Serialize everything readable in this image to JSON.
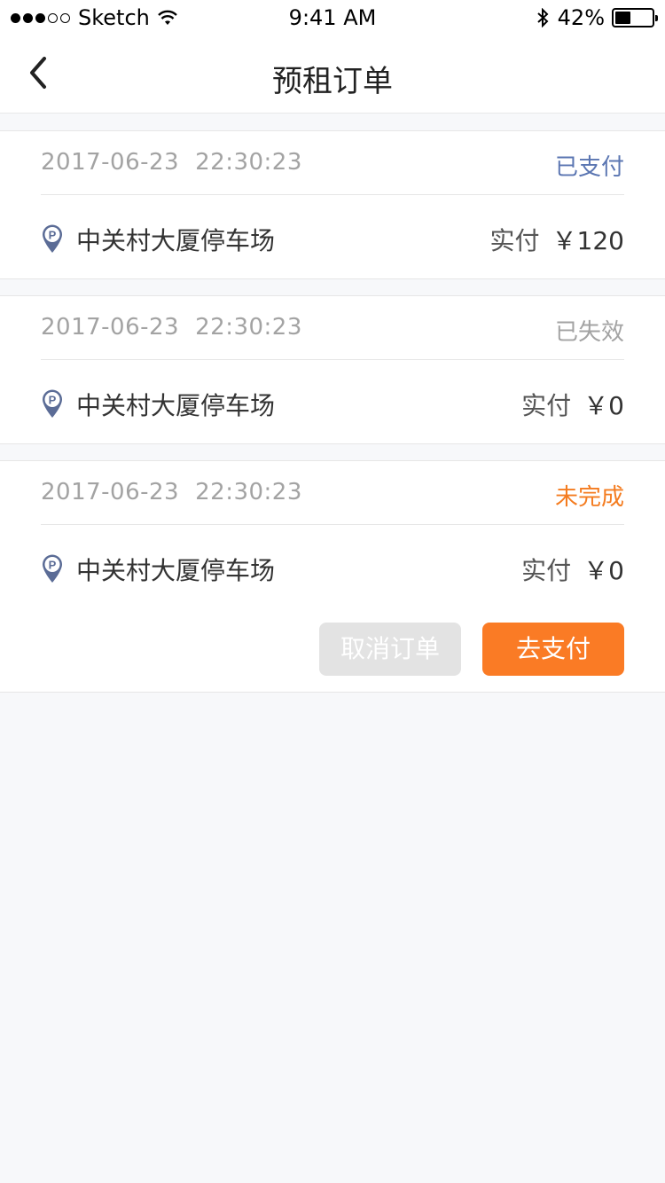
{
  "status_bar": {
    "carrier": "Sketch",
    "time": "9:41 AM",
    "battery_percent": "42%",
    "battery_level": 0.42
  },
  "nav": {
    "title": "预租订单",
    "back_icon": "chevron-left-icon"
  },
  "orders": [
    {
      "date": "2017-06-23",
      "time": "22:30:23",
      "status": "已支付",
      "status_color": "#5b76b2",
      "lot_name": "中关村大厦停车场",
      "paid_label": "实付",
      "amount": "￥120"
    },
    {
      "date": "2017-06-23",
      "time": "22:30:23",
      "status": "已失效",
      "status_color": "#a3a3a3",
      "lot_name": "中关村大厦停车场",
      "paid_label": "实付",
      "amount": "￥0"
    },
    {
      "date": "2017-06-23",
      "time": "22:30:23",
      "status": "未完成",
      "status_color": "#f47c20",
      "lot_name": "中关村大厦停车场",
      "paid_label": "实付",
      "amount": "￥0"
    }
  ],
  "actions": {
    "cancel_label": "取消订单",
    "pay_label": "去支付",
    "pay_color": "#fa7b25"
  },
  "colors": {
    "pin": "#5b6c96",
    "background": "#f7f8fa"
  }
}
